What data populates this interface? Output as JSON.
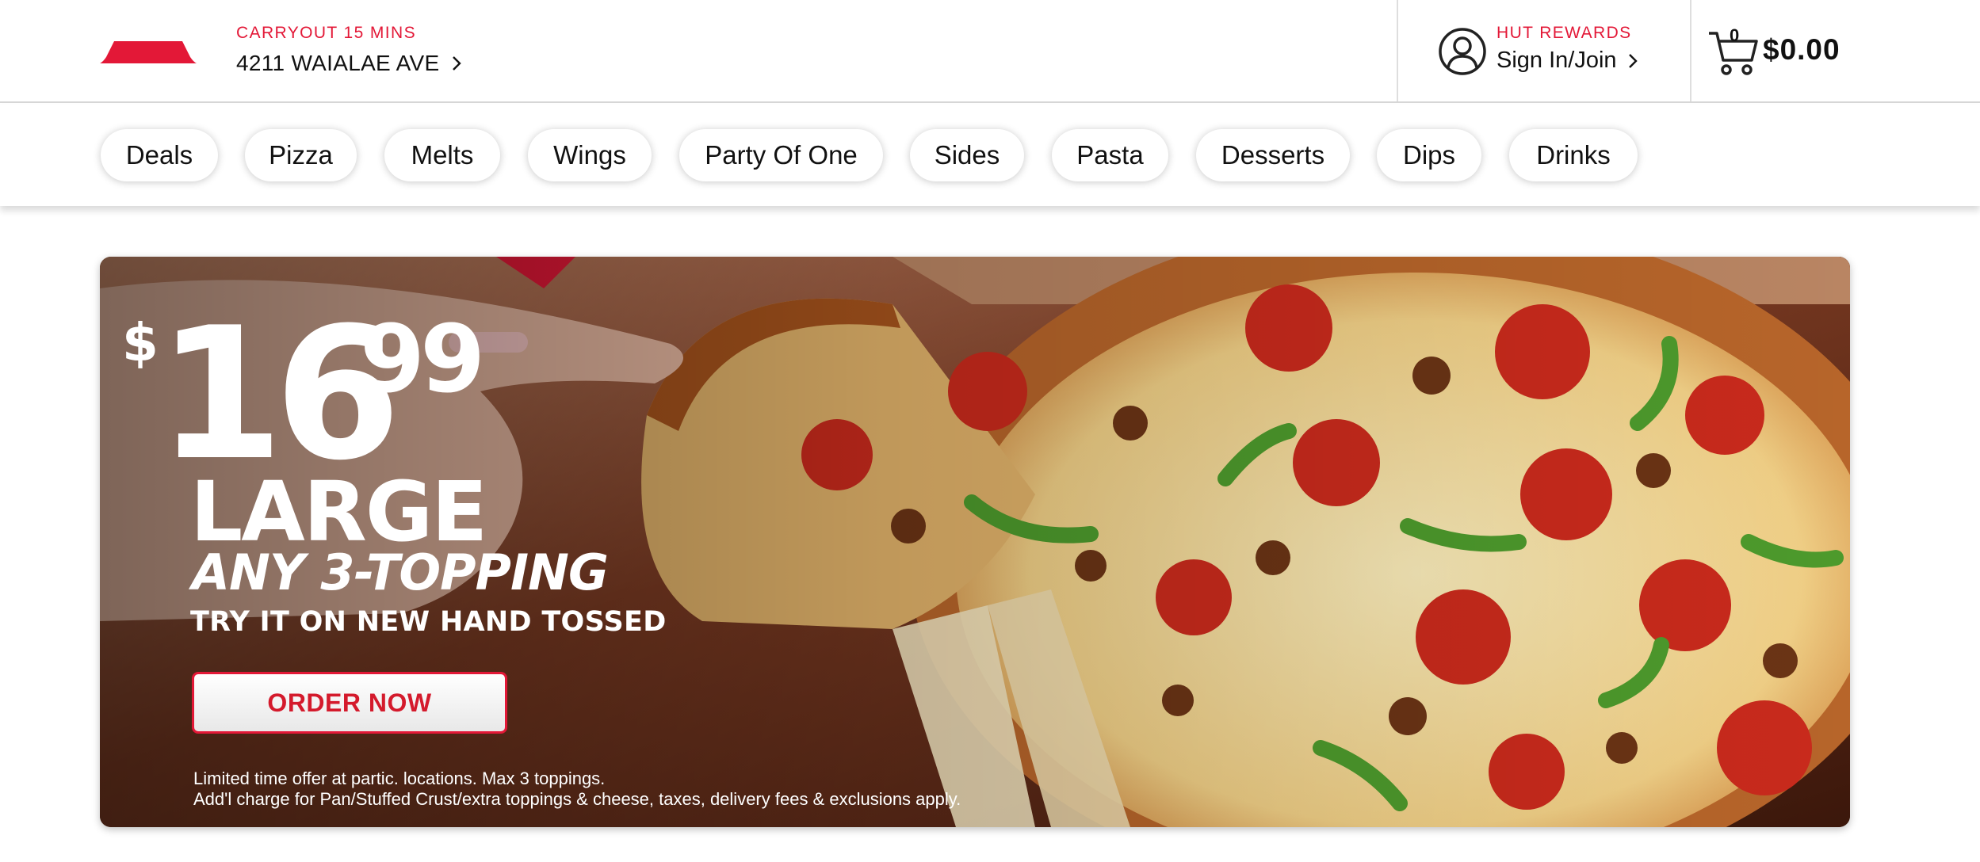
{
  "header": {
    "carryout_label": "CARRYOUT 15 MINS",
    "address": "4211 WAIALAE AVE",
    "rewards_label": "HUT REWARDS",
    "sign_in": "Sign In/Join",
    "cart_count": "0",
    "cart_total": "$0.00"
  },
  "categories": [
    {
      "label": "Deals"
    },
    {
      "label": "Pizza"
    },
    {
      "label": "Melts"
    },
    {
      "label": "Wings"
    },
    {
      "label": "Party Of One"
    },
    {
      "label": "Sides"
    },
    {
      "label": "Pasta"
    },
    {
      "label": "Desserts"
    },
    {
      "label": "Dips"
    },
    {
      "label": "Drinks"
    }
  ],
  "hero": {
    "price_dollar": "$",
    "price_main": "16",
    "price_cents": "99",
    "size": "LARGE",
    "offer": "ANY 3-TOPPING",
    "subline": "TRY IT ON NEW HAND TOSSED",
    "cta": "ORDER NOW",
    "fine_print_1": "Limited time offer at partic. locations. Max 3 toppings.",
    "fine_print_2": "Add'l charge for Pan/Stuffed Crust/extra toppings & cheese, taxes, delivery fees & exclusions apply."
  },
  "colors": {
    "brand_red": "#e31837",
    "text_dark": "#111111"
  },
  "icons": {
    "logo": "pizza-hut-roof-logo",
    "location_chevron": "chevron-right-icon",
    "account": "user-circle-icon",
    "cart": "shopping-cart-icon"
  }
}
